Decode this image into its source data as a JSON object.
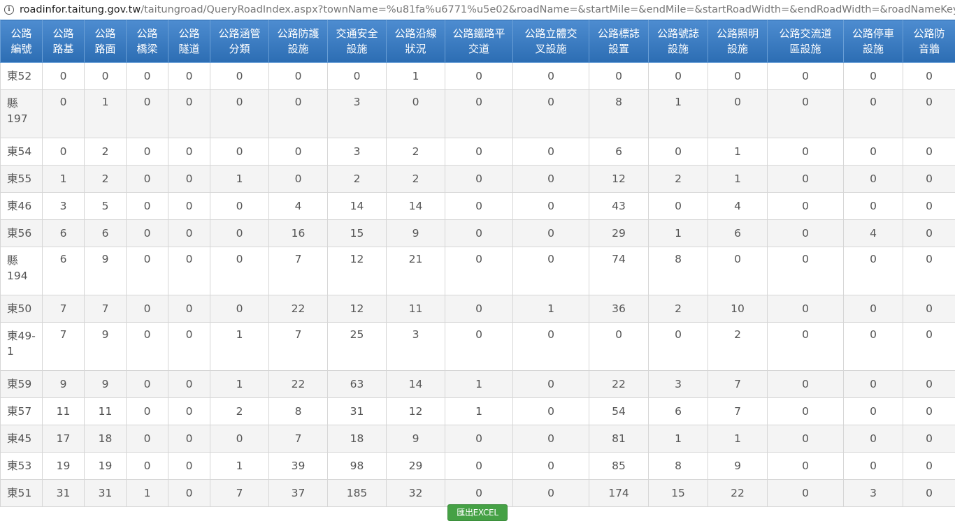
{
  "browser": {
    "url_host": "roadinfor.taitung.gov.tw",
    "url_path": "/taitungroad/QueryRoadIndex.aspx?townName=%u81fa%u6771%u5e02&roadName=&startMile=&endMile=&startRoadWidth=&endRoadWidth=&roadNameKeyWord=&util..."
  },
  "table": {
    "headers": [
      [
        "公路",
        "編號"
      ],
      [
        "公路",
        "路基"
      ],
      [
        "公路",
        "路面"
      ],
      [
        "公路",
        "橋梁"
      ],
      [
        "公路",
        "隧道"
      ],
      [
        "公路涵管",
        "分類"
      ],
      [
        "公路防護",
        "設施"
      ],
      [
        "交通安全",
        "設施"
      ],
      [
        "公路沿線",
        "狀況"
      ],
      [
        "公路鐵路平",
        "交道"
      ],
      [
        "公路立體交",
        "叉設施"
      ],
      [
        "公路標誌",
        "設置"
      ],
      [
        "公路號誌",
        "設施"
      ],
      [
        "公路照明",
        "設施"
      ],
      [
        "公路交流道",
        "區設施"
      ],
      [
        "公路停車",
        "設施"
      ],
      [
        "公路防",
        "音牆"
      ]
    ],
    "rows": [
      {
        "code": [
          "東52"
        ],
        "values": [
          "0",
          "0",
          "0",
          "0",
          "0",
          "0",
          "0",
          "1",
          "0",
          "0",
          "0",
          "0",
          "0",
          "0",
          "0",
          "0"
        ]
      },
      {
        "code": [
          "縣",
          "197"
        ],
        "values": [
          "0",
          "1",
          "0",
          "0",
          "0",
          "0",
          "3",
          "0",
          "0",
          "0",
          "8",
          "1",
          "0",
          "0",
          "0",
          "0"
        ]
      },
      {
        "code": [
          "東54"
        ],
        "values": [
          "0",
          "2",
          "0",
          "0",
          "0",
          "0",
          "3",
          "2",
          "0",
          "0",
          "6",
          "0",
          "1",
          "0",
          "0",
          "0"
        ]
      },
      {
        "code": [
          "東55"
        ],
        "values": [
          "1",
          "2",
          "0",
          "0",
          "1",
          "0",
          "2",
          "2",
          "0",
          "0",
          "12",
          "2",
          "1",
          "0",
          "0",
          "0"
        ]
      },
      {
        "code": [
          "東46"
        ],
        "values": [
          "3",
          "5",
          "0",
          "0",
          "0",
          "4",
          "14",
          "14",
          "0",
          "0",
          "43",
          "0",
          "4",
          "0",
          "0",
          "0"
        ]
      },
      {
        "code": [
          "東56"
        ],
        "values": [
          "6",
          "6",
          "0",
          "0",
          "0",
          "16",
          "15",
          "9",
          "0",
          "0",
          "29",
          "1",
          "6",
          "0",
          "4",
          "0"
        ]
      },
      {
        "code": [
          "縣",
          "194"
        ],
        "values": [
          "6",
          "9",
          "0",
          "0",
          "0",
          "7",
          "12",
          "21",
          "0",
          "0",
          "74",
          "8",
          "0",
          "0",
          "0",
          "0"
        ]
      },
      {
        "code": [
          "東50"
        ],
        "values": [
          "7",
          "7",
          "0",
          "0",
          "0",
          "22",
          "12",
          "11",
          "0",
          "1",
          "36",
          "2",
          "10",
          "0",
          "0",
          "0"
        ]
      },
      {
        "code": [
          "東49-",
          "1"
        ],
        "values": [
          "7",
          "9",
          "0",
          "0",
          "1",
          "7",
          "25",
          "3",
          "0",
          "0",
          "0",
          "0",
          "2",
          "0",
          "0",
          "0"
        ]
      },
      {
        "code": [
          "東59"
        ],
        "values": [
          "9",
          "9",
          "0",
          "0",
          "1",
          "22",
          "63",
          "14",
          "1",
          "0",
          "22",
          "3",
          "7",
          "0",
          "0",
          "0"
        ]
      },
      {
        "code": [
          "東57"
        ],
        "values": [
          "11",
          "11",
          "0",
          "0",
          "2",
          "8",
          "31",
          "12",
          "1",
          "0",
          "54",
          "6",
          "7",
          "0",
          "0",
          "0"
        ]
      },
      {
        "code": [
          "東45"
        ],
        "values": [
          "17",
          "18",
          "0",
          "0",
          "0",
          "7",
          "18",
          "9",
          "0",
          "0",
          "81",
          "1",
          "1",
          "0",
          "0",
          "0"
        ]
      },
      {
        "code": [
          "東53"
        ],
        "values": [
          "19",
          "19",
          "0",
          "0",
          "1",
          "39",
          "98",
          "29",
          "0",
          "0",
          "85",
          "8",
          "9",
          "0",
          "0",
          "0"
        ]
      },
      {
        "code": [
          "東51"
        ],
        "values": [
          "31",
          "31",
          "1",
          "0",
          "7",
          "37",
          "185",
          "32",
          "0",
          "0",
          "174",
          "15",
          "22",
          "0",
          "3",
          "0"
        ]
      }
    ]
  },
  "export_button": {
    "label": "匯出EXCEL"
  }
}
